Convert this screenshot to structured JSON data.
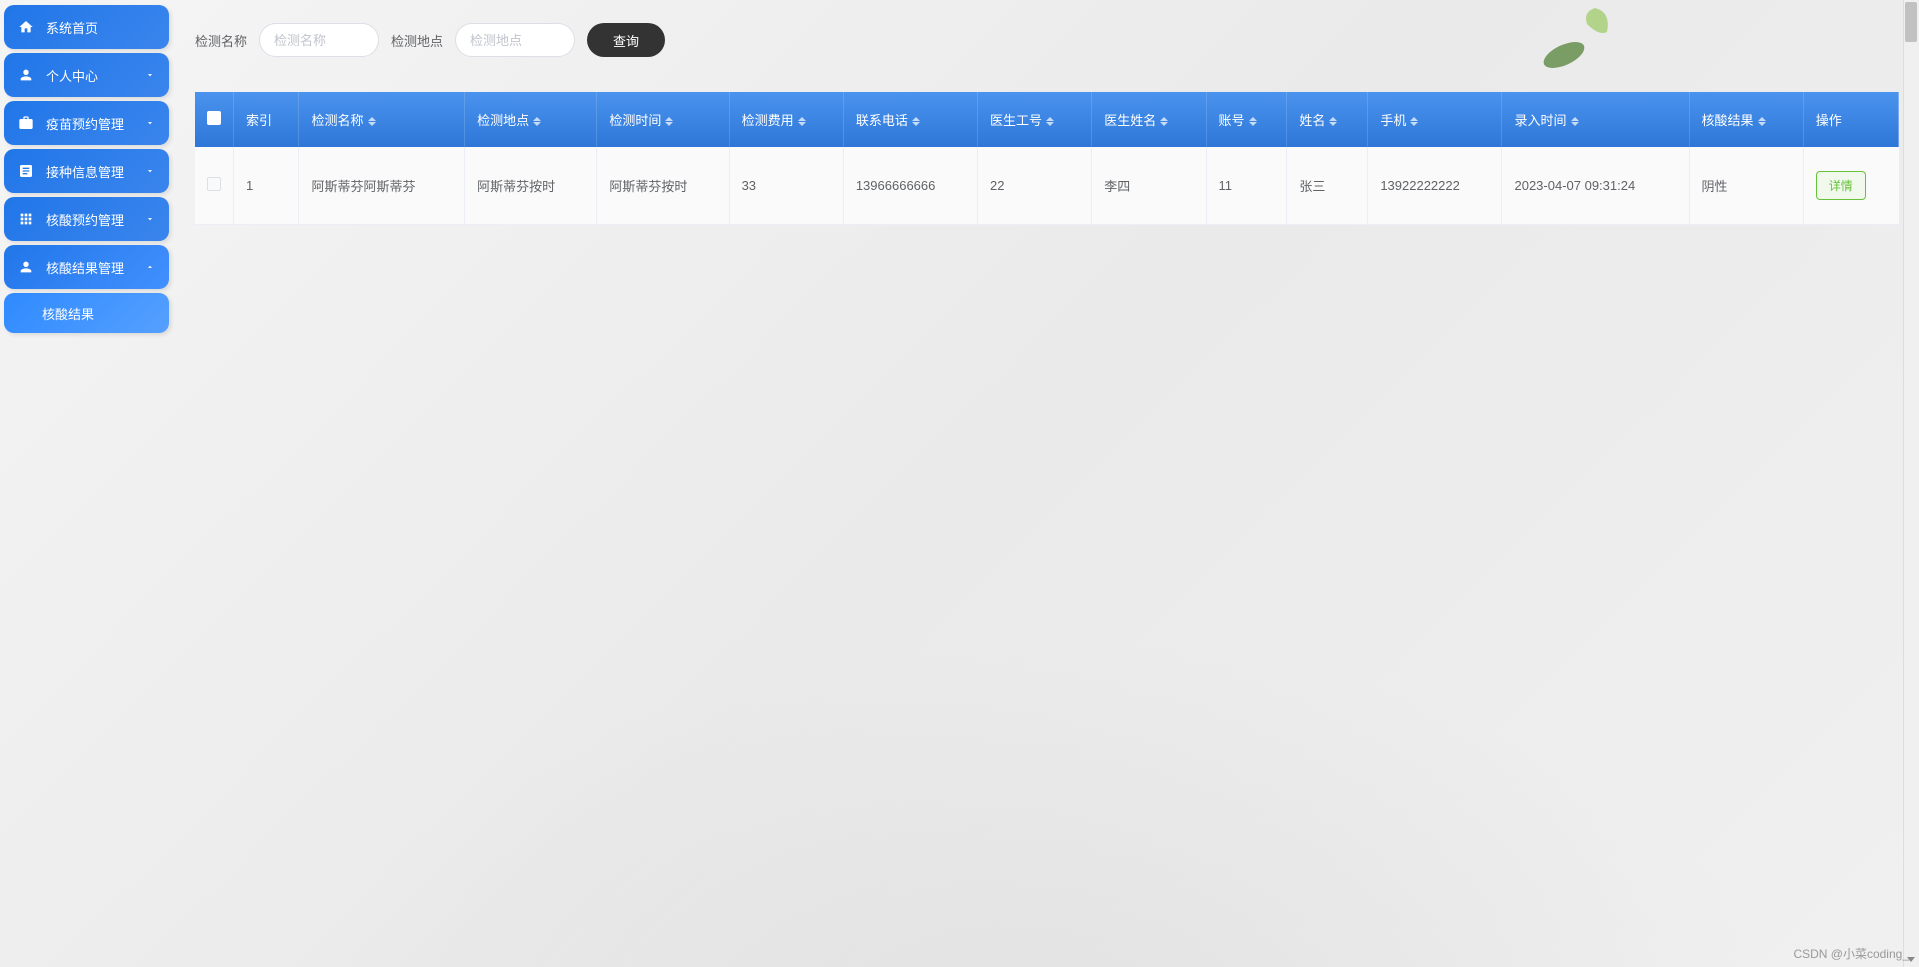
{
  "sidebar": {
    "items": [
      {
        "label": "系统首页",
        "icon": "home"
      },
      {
        "label": "个人中心",
        "icon": "user",
        "chevron": "down"
      },
      {
        "label": "疫苗预约管理",
        "icon": "briefcase",
        "chevron": "down"
      },
      {
        "label": "接种信息管理",
        "icon": "note",
        "chevron": "down"
      },
      {
        "label": "核酸预约管理",
        "icon": "grid",
        "chevron": "down"
      },
      {
        "label": "核酸结果管理",
        "icon": "user-alt",
        "chevron": "up"
      }
    ],
    "subitems": [
      {
        "label": "核酸结果"
      }
    ]
  },
  "search": {
    "name_label": "检测名称",
    "name_placeholder": "检测名称",
    "location_label": "检测地点",
    "location_placeholder": "检测地点",
    "button_label": "查询"
  },
  "table": {
    "headers": {
      "index": "索引",
      "test_name": "检测名称",
      "test_location": "检测地点",
      "test_time": "检测时间",
      "test_fee": "检测费用",
      "contact_phone": "联系电话",
      "doctor_id": "医生工号",
      "doctor_name": "医生姓名",
      "account": "账号",
      "name": "姓名",
      "phone": "手机",
      "entry_time": "录入时间",
      "result": "核酸结果",
      "action": "操作"
    },
    "rows": [
      {
        "index": "1",
        "test_name": "阿斯蒂芬阿斯蒂芬",
        "test_location": "阿斯蒂芬按时",
        "test_time": "阿斯蒂芬按时",
        "test_fee": "33",
        "contact_phone": "13966666666",
        "doctor_id": "22",
        "doctor_name": "李四",
        "account": "11",
        "name": "张三",
        "phone": "13922222222",
        "entry_time": "2023-04-07 09:31:24",
        "result": "阴性",
        "action_label": "详情"
      }
    ]
  },
  "watermark": "CSDN @小菜coding_",
  "colors": {
    "nav_gradient_start": "#2176e8",
    "nav_gradient_end": "#3a85ed",
    "table_header_start": "#4a93ee",
    "table_header_end": "#2e77d8",
    "detail_button": "#67c23a",
    "search_button": "#333333"
  }
}
